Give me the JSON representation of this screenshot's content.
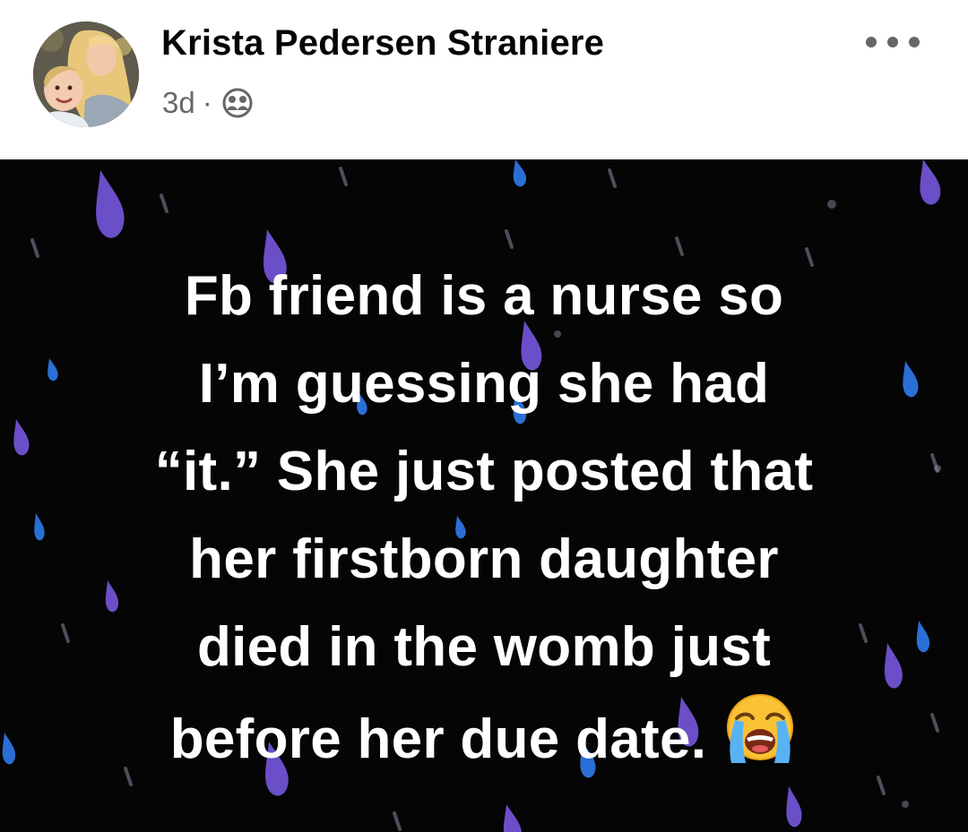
{
  "post": {
    "author": "Krista Pedersen Straniere",
    "time": "3d",
    "separator": "·",
    "audience_icon": "friends-icon",
    "menu_icon": "more-options-icon",
    "background": "dark-rain-drops",
    "text_lines": [
      "Fb friend is a nurse so",
      "I’m guessing she had",
      "“it.” She just posted that",
      "her firstborn daughter",
      "died in the womb just",
      "before her due date."
    ],
    "emoji": "loudly-crying-face-emoji"
  },
  "colors": {
    "author": "#050505",
    "meta": "#65676b",
    "post_background": "#050505",
    "post_text": "#ffffff",
    "drop_purple": "#6a4fc8",
    "drop_blue": "#2a6fd6"
  }
}
